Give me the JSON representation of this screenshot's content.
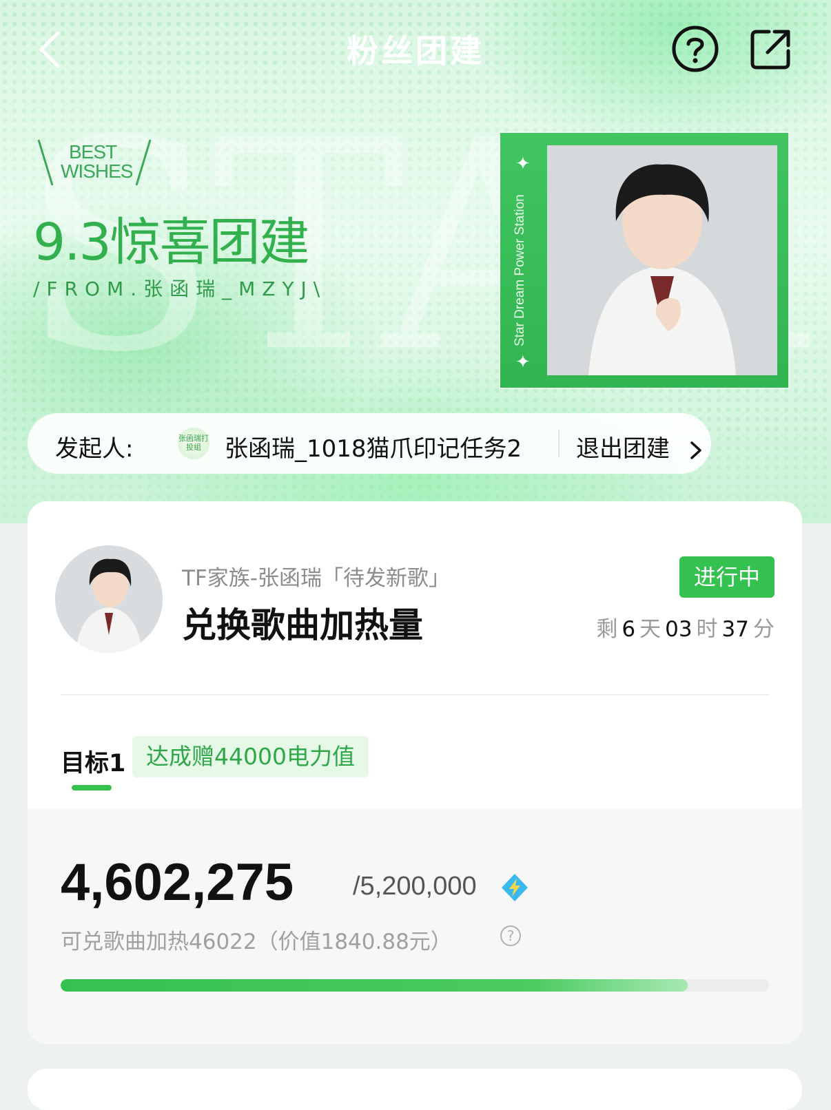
{
  "nav": {
    "title": "粉丝团建"
  },
  "hero": {
    "badge_line1": "BEST",
    "badge_line2": "WISHES",
    "event_title": "9.3惊喜团建",
    "from_line": "/FROM.张函瑞_MZYJ\\",
    "photo_caption": "Star Dream Power Station",
    "background_text": "STAR DREAM"
  },
  "initiator": {
    "label": "发起人:",
    "avatar_text": "张函瑞打投组",
    "name": "张函瑞_1018猫爪印记任务2",
    "exit_label": "退出团建"
  },
  "task": {
    "subtitle": "TF家族-张函瑞「待发新歌」",
    "title": "兑换歌曲加热量",
    "status": "进行中",
    "countdown": {
      "prefix": "剩",
      "days": "6",
      "days_unit": "天",
      "hours": "03",
      "hours_unit": "时",
      "minutes": "37",
      "minutes_unit": "分"
    }
  },
  "goal": {
    "tab_label": "目标1",
    "reward": "达成赠44000电力值",
    "current": "4,602,275",
    "target": "/5,200,000",
    "exchange_text": "可兑歌曲加热46022（价值1840.88元）",
    "progress_fraction": 0.885
  },
  "colors": {
    "accent": "#35c14f",
    "title_green": "#33b04e"
  }
}
